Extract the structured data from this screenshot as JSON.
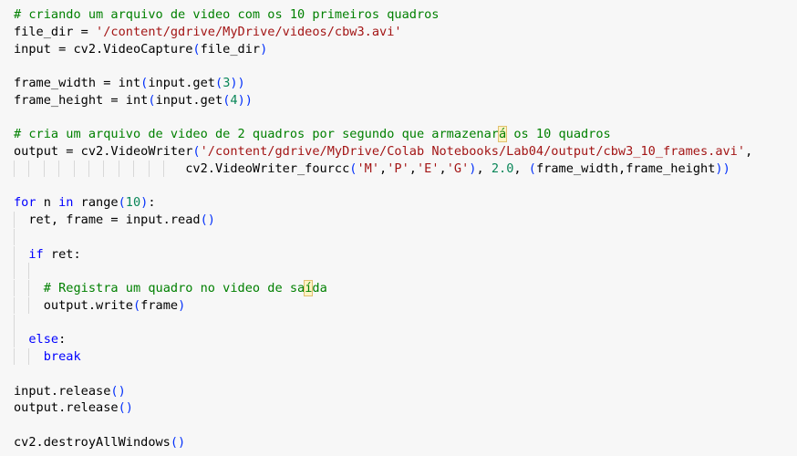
{
  "editor": {
    "theme_colors": {
      "background": "#f7f7f7",
      "keyword": "#0000ff",
      "string": "#a31515",
      "number": "#098658",
      "comment": "#008000",
      "bracket": "#0431fa",
      "highlight": "#fff3c4"
    },
    "lines": [
      {
        "tokens": [
          {
            "t": "# criando um arquivo de video com os 10 primeiros quadros",
            "c": "cmt"
          }
        ]
      },
      {
        "tokens": [
          {
            "t": "file_dir = "
          },
          {
            "t": "'/content/gdrive/MyDrive/videos/cbw3.avi'",
            "c": "str"
          }
        ]
      },
      {
        "tokens": [
          {
            "t": "input = cv2.VideoCapture"
          },
          {
            "t": "(",
            "c": "par"
          },
          {
            "t": "file_dir"
          },
          {
            "t": ")",
            "c": "par"
          }
        ]
      },
      {
        "tokens": []
      },
      {
        "tokens": [
          {
            "t": "frame_width = int"
          },
          {
            "t": "(",
            "c": "par"
          },
          {
            "t": "input.get"
          },
          {
            "t": "(",
            "c": "par"
          },
          {
            "t": "3",
            "c": "num"
          },
          {
            "t": "))",
            "c": "par"
          }
        ]
      },
      {
        "tokens": [
          {
            "t": "frame_height = int"
          },
          {
            "t": "(",
            "c": "par"
          },
          {
            "t": "input.get"
          },
          {
            "t": "(",
            "c": "par"
          },
          {
            "t": "4",
            "c": "num"
          },
          {
            "t": "))",
            "c": "par"
          }
        ]
      },
      {
        "tokens": []
      },
      {
        "tokens": [
          {
            "t": "# cria um arquivo de video de 2 quadros por segundo que armazenar",
            "c": "cmt"
          },
          {
            "t": "á",
            "c": "cmt hl"
          },
          {
            "t": " os 10 quadros",
            "c": "cmt"
          }
        ]
      },
      {
        "tokens": [
          {
            "t": "output = cv2.VideoWriter"
          },
          {
            "t": "(",
            "c": "par"
          },
          {
            "t": "'/content/gdrive/MyDrive/Colab Notebooks/Lab04/output/cbw3_10_frames.avi'",
            "c": "str"
          },
          {
            "t": ","
          }
        ]
      },
      {
        "guides": 11,
        "tokens": [
          {
            "t": "                       cv2.VideoWriter_fourcc"
          },
          {
            "t": "(",
            "c": "par"
          },
          {
            "t": "'M'",
            "c": "str"
          },
          {
            "t": ","
          },
          {
            "t": "'P'",
            "c": "str"
          },
          {
            "t": ","
          },
          {
            "t": "'E'",
            "c": "str"
          },
          {
            "t": ","
          },
          {
            "t": "'G'",
            "c": "str"
          },
          {
            "t": ")",
            "c": "par"
          },
          {
            "t": ", "
          },
          {
            "t": "2.0",
            "c": "num"
          },
          {
            "t": ", "
          },
          {
            "t": "(",
            "c": "par"
          },
          {
            "t": "frame_width,frame_height"
          },
          {
            "t": "))",
            "c": "par"
          }
        ]
      },
      {
        "tokens": []
      },
      {
        "tokens": [
          {
            "t": "for",
            "c": "kw"
          },
          {
            "t": " n "
          },
          {
            "t": "in",
            "c": "kw"
          },
          {
            "t": " range"
          },
          {
            "t": "(",
            "c": "par"
          },
          {
            "t": "10",
            "c": "num"
          },
          {
            "t": ")",
            "c": "par"
          },
          {
            "t": ":"
          }
        ]
      },
      {
        "guides": 1,
        "tokens": [
          {
            "t": "  ret, frame = input.read"
          },
          {
            "t": "()",
            "c": "par"
          }
        ]
      },
      {
        "guides": 1,
        "tokens": []
      },
      {
        "guides": 1,
        "tokens": [
          {
            "t": "  "
          },
          {
            "t": "if",
            "c": "kw"
          },
          {
            "t": " ret:"
          }
        ]
      },
      {
        "guides": 2,
        "tokens": []
      },
      {
        "guides": 2,
        "tokens": [
          {
            "t": "    "
          },
          {
            "t": "# Registra um quadro no video de sa",
            "c": "cmt"
          },
          {
            "t": "í",
            "c": "cmt hl"
          },
          {
            "t": "da",
            "c": "cmt"
          }
        ]
      },
      {
        "guides": 2,
        "tokens": [
          {
            "t": "    output.write"
          },
          {
            "t": "(",
            "c": "par"
          },
          {
            "t": "frame"
          },
          {
            "t": ")",
            "c": "par"
          }
        ]
      },
      {
        "guides": 1,
        "tokens": []
      },
      {
        "guides": 1,
        "tokens": [
          {
            "t": "  "
          },
          {
            "t": "else",
            "c": "kw"
          },
          {
            "t": ":"
          }
        ]
      },
      {
        "guides": 2,
        "tokens": [
          {
            "t": "    "
          },
          {
            "t": "break",
            "c": "kw"
          }
        ]
      },
      {
        "tokens": []
      },
      {
        "tokens": [
          {
            "t": "input.release"
          },
          {
            "t": "()",
            "c": "par"
          }
        ]
      },
      {
        "tokens": [
          {
            "t": "output.release"
          },
          {
            "t": "()",
            "c": "par"
          }
        ]
      },
      {
        "tokens": []
      },
      {
        "tokens": [
          {
            "t": "cv2.destroyAllWindows"
          },
          {
            "t": "()",
            "c": "par"
          }
        ]
      }
    ]
  }
}
